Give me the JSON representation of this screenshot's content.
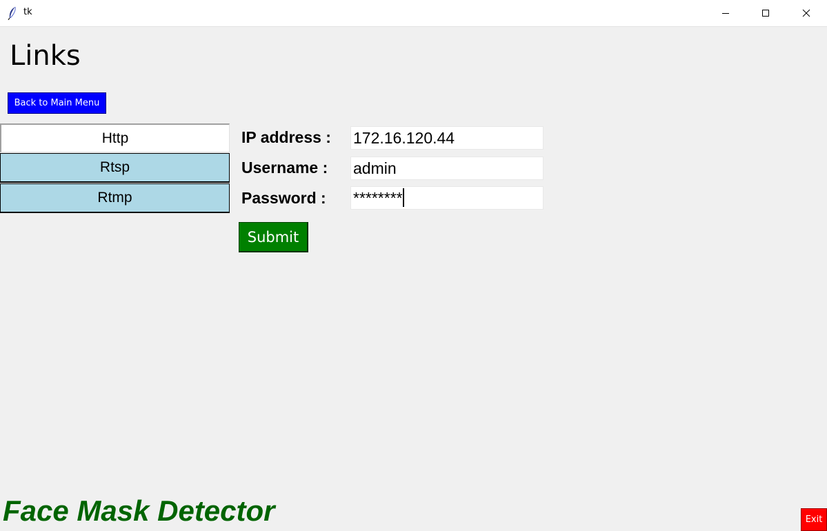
{
  "window": {
    "title": "tk",
    "app_icon": "feather-icon",
    "controls": {
      "minimize_icon": "minimize-icon",
      "maximize_icon": "maximize-icon",
      "close_icon": "close-icon"
    }
  },
  "page": {
    "title": "Links",
    "back_button_label": "Back to Main Menu",
    "footer_title": "Face Mask Detector",
    "exit_label": "Exit"
  },
  "tabs": [
    {
      "label": "Http",
      "selected": true
    },
    {
      "label": "Rtsp",
      "selected": false
    },
    {
      "label": "Rtmp",
      "selected": false
    }
  ],
  "form": {
    "ip_label": "IP address :",
    "ip_value": "172.16.120.44",
    "username_label": "Username :",
    "username_value": "admin",
    "password_label": "Password :",
    "password_value": "********",
    "submit_label": "Submit"
  },
  "colors": {
    "window_bg": "#f0f0f0",
    "back_button": "#0000ff",
    "tab_unselected": "#add8e6",
    "submit_button": "#008000",
    "footer_title": "#006400",
    "exit_button": "#ff0000"
  }
}
